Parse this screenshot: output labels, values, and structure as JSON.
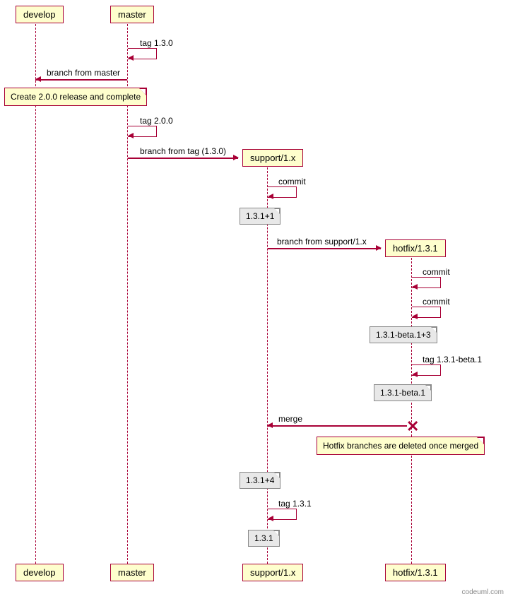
{
  "participants": {
    "develop": "develop",
    "master": "master",
    "support": "support/1.x",
    "hotfix": "hotfix/1.3.1"
  },
  "messages": {
    "tag130": "tag 1.3.0",
    "branchFromMaster": "branch from master",
    "noteRelease": "Create 2.0.0 release and complete",
    "tag200": "tag 2.0.0",
    "branchFromTag": "branch from tag (1.3.0)",
    "commit": "commit",
    "v131p1": "1.3.1+1",
    "branchFromSupport": "branch from support/1.x",
    "v131b1p3": "1.3.1-beta.1+3",
    "tag131b1": "tag 1.3.1-beta.1",
    "v131b1": "1.3.1-beta.1",
    "merge": "merge",
    "noteHotfix": "Hotfix branches are deleted once merged",
    "v131p4": "1.3.1+4",
    "tag131": "tag 1.3.1",
    "v131": "1.3.1"
  },
  "footer": "codeuml.com"
}
